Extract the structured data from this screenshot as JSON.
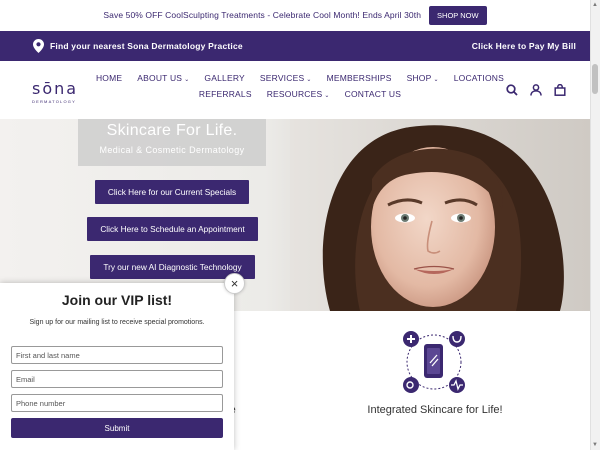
{
  "announcement": {
    "text": "Save 50% OFF CoolSculpting Treatments - Celebrate Cool Month! Ends April 30th",
    "button": "SHOP NOW"
  },
  "locator_bar": {
    "find_text": "Find your nearest Sona Dermatology Practice",
    "pay_text": "Click Here to Pay My Bill",
    "pin_icon": "map-pin-icon"
  },
  "logo": {
    "main": "sōna",
    "sub": "DERMATOLOGY"
  },
  "nav": {
    "row1": [
      {
        "label": "HOME",
        "caret": ""
      },
      {
        "label": "ABOUT US",
        "caret": "⌄"
      },
      {
        "label": "GALLERY",
        "caret": ""
      },
      {
        "label": "SERVICES",
        "caret": "⌄"
      },
      {
        "label": "MEMBERSHIPS",
        "caret": ""
      },
      {
        "label": "SHOP",
        "caret": "⌄"
      },
      {
        "label": "LOCATIONS",
        "caret": ""
      }
    ],
    "row2": [
      {
        "label": "REFERRALS",
        "caret": ""
      },
      {
        "label": "RESOURCES",
        "caret": "⌄"
      },
      {
        "label": "CONTACT US",
        "caret": ""
      }
    ]
  },
  "header_icons": [
    "search-icon",
    "account-icon",
    "cart-icon"
  ],
  "hero": {
    "tagline": "Skincare For Life.",
    "tagline_sub": "Medical & Cosmetic Dermatology",
    "cta1": "Click Here for our Current Specials",
    "cta2": "Click Here to Schedule an Appointment",
    "cta3": "Try our new AI Diagnostic Technology"
  },
  "features": {
    "left_title_fragment": "re",
    "right_title": "Integrated Skincare for Life!"
  },
  "popup": {
    "title": "Join our VIP list!",
    "subtitle": "Sign up for our mailing list to receive special promotions.",
    "name_placeholder": "First and last name",
    "email_placeholder": "Email",
    "phone_placeholder": "Phone number",
    "submit": "Submit",
    "close": "×"
  },
  "colors": {
    "brand_purple": "#3b2870",
    "white": "#ffffff"
  }
}
